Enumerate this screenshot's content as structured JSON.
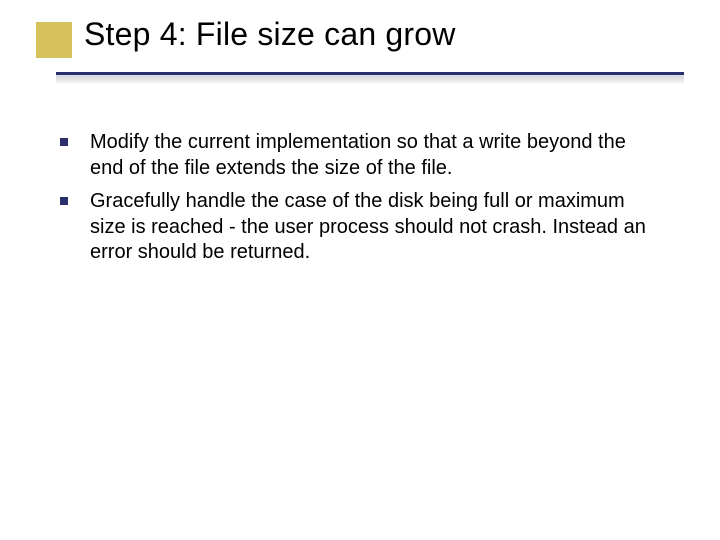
{
  "slide": {
    "title": "Step 4: File size can grow",
    "bullets": [
      "Modify the current implementation so that a write beyond the end of the file extends the size of the file.",
      "Gracefully handle the case of the disk being full or maximum size is reached - the user process should not crash. Instead an error should be returned."
    ]
  }
}
